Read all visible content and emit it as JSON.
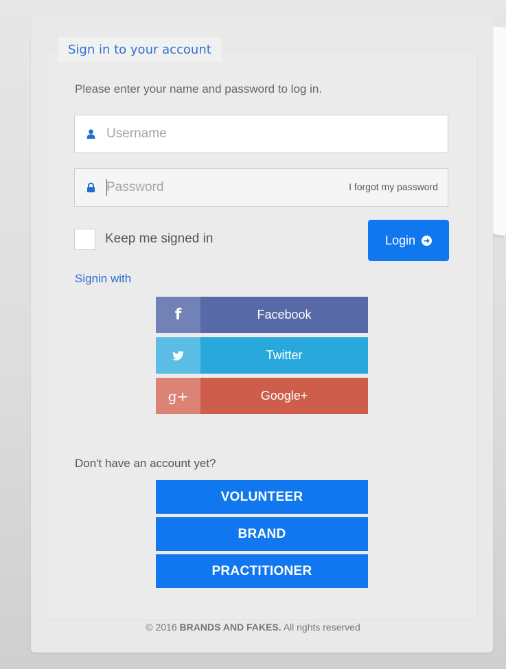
{
  "form": {
    "title": "Sign in to your account",
    "instructions": "Please enter your name and password to log in.",
    "username_placeholder": "Username",
    "password_placeholder": "Password",
    "forgot_password": "I forgot my password",
    "keep_signed_in": "Keep me signed in",
    "login_label": "Login"
  },
  "social": {
    "heading": "Signin with",
    "buttons": [
      {
        "label": "Facebook",
        "icon": "facebook-icon",
        "color": "#5769a6"
      },
      {
        "label": "Twitter",
        "icon": "twitter-icon",
        "color": "#29a8db"
      },
      {
        "label": "Google+",
        "icon": "google-plus-icon",
        "color": "#cf5d4b"
      }
    ]
  },
  "register": {
    "prompt": "Don't have an account yet?",
    "buttons": [
      "VOLUNTEER",
      "BRAND",
      "PRACTITIONER"
    ]
  },
  "footer": {
    "prefix": "© 2016",
    "brand": "BRANDS AND FAKES.",
    "suffix": "All rights reserved"
  },
  "colors": {
    "accent": "#1177ee",
    "link": "#2f6fd1"
  }
}
